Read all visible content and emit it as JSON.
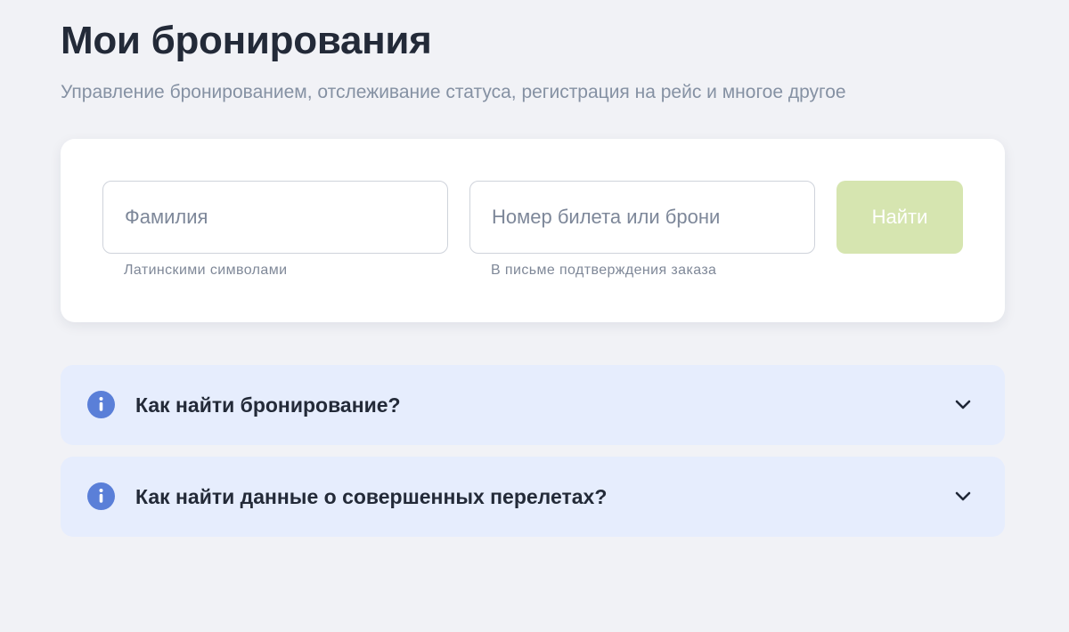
{
  "header": {
    "title": "Мои бронирования",
    "subtitle": "Управление бронированием, отслеживание статуса, регистрация на рейс и многое другое"
  },
  "search": {
    "surname": {
      "value": "",
      "placeholder": "Фамилия",
      "hint": "Латинскими символами"
    },
    "ticket": {
      "value": "",
      "placeholder": "Номер билета или брони",
      "hint": "В письме подтверждения заказа"
    },
    "find_label": "Найти"
  },
  "faq": {
    "items": [
      {
        "label": "Как найти бронирование?",
        "icon": "info-icon",
        "expanded": false
      },
      {
        "label": "Как найти данные о совершенных перелетах?",
        "icon": "info-icon",
        "expanded": false
      }
    ]
  },
  "colors": {
    "background": "#f1f2f6",
    "card": "#ffffff",
    "accent_blue": "#5a7fd8",
    "button_disabled": "#d6e5b0",
    "faq_background": "#e6edfd"
  }
}
